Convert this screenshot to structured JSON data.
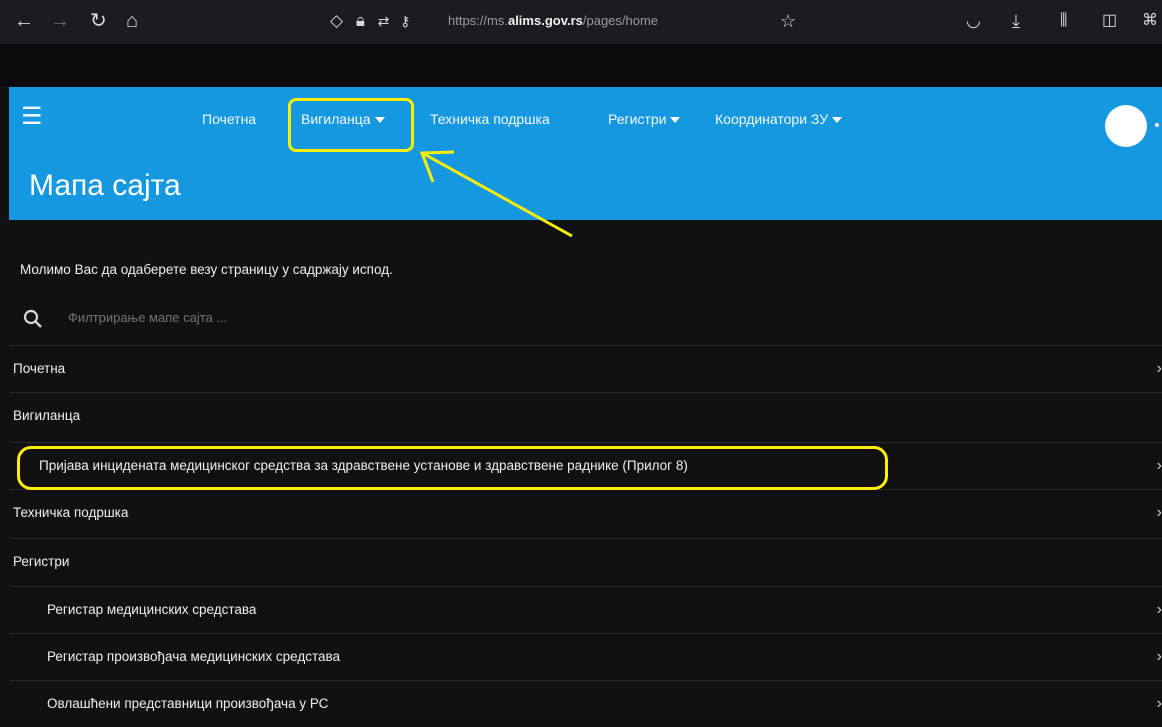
{
  "browser": {
    "url_prefix": "https://ms.",
    "url_domain": "alims.gov.rs",
    "url_path": "/pages/home"
  },
  "header": {
    "nav": [
      {
        "label": "Почетна",
        "has_dropdown": false
      },
      {
        "label": "Вигиланца",
        "has_dropdown": true
      },
      {
        "label": "Техничка подршка",
        "has_dropdown": false
      },
      {
        "label": "Регистри",
        "has_dropdown": true
      },
      {
        "label": "Координатори ЗУ",
        "has_dropdown": true
      }
    ],
    "page_title": "Мапа сајта",
    "bg_color": "#1598e0"
  },
  "content": {
    "intro": "Молимо Вас да одаберете везу страницу у садржају испод.",
    "search_placeholder": "Филтрирање мапе сајта ...",
    "rows": [
      {
        "label": "Почетна",
        "level": 0,
        "has_chevron": true
      },
      {
        "label": "Вигиланца",
        "level": 0,
        "has_chevron": false
      },
      {
        "label": "Пријава инцидената медицинског средства за здравствене установе и здравствене раднике (Прилог 8)",
        "level": 1,
        "has_chevron": true
      },
      {
        "label": "Техничка подршка",
        "level": 0,
        "has_chevron": true
      },
      {
        "label": "Регистри",
        "level": 0,
        "has_chevron": false
      },
      {
        "label": "Регистар медицинских средстава",
        "level": 1,
        "has_chevron": true
      },
      {
        "label": "Регистар произвођача медицинских средстава",
        "level": 1,
        "has_chevron": true
      },
      {
        "label": "Овлашћени представници произвођача у РС",
        "level": 1,
        "has_chevron": true
      }
    ]
  },
  "annotation_color": "#ffee00"
}
